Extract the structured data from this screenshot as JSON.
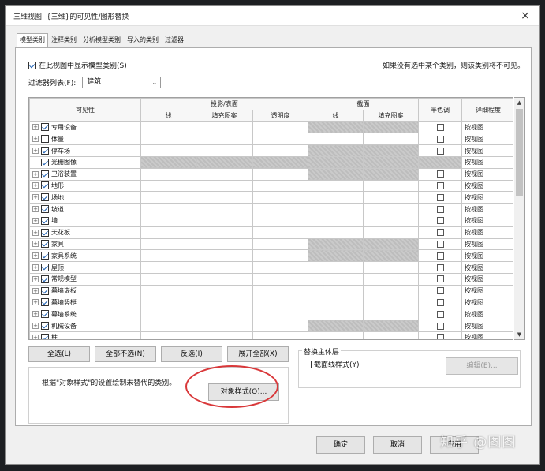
{
  "window": {
    "title": "三维视图: {三维}的可见性/图形替换",
    "close": "×"
  },
  "tabs": [
    {
      "label": "模型类别",
      "active": true
    },
    {
      "label": "注释类别",
      "active": false
    },
    {
      "label": "分析模型类别",
      "active": false
    },
    {
      "label": "导入的类别",
      "active": false
    },
    {
      "label": "过滤器",
      "active": false
    }
  ],
  "show_models": {
    "label": "在此视图中显示模型类别(S)",
    "checked": true
  },
  "hint": "如果没有选中某个类别，则该类别将不可见。",
  "filter": {
    "label": "过滤器列表(F):",
    "value": "建筑"
  },
  "grid": {
    "headers": {
      "visibility": "可见性",
      "projection": "投影/表面",
      "section": "截面",
      "halftone": "半色调",
      "detail": "详细程度",
      "line": "线",
      "fill": "填充图案",
      "transparency": "透明度",
      "section_line": "线",
      "section_fill": "填充图案"
    },
    "rows": [
      {
        "name": "专用设备",
        "checked": true,
        "expandable": true,
        "section_gray": true,
        "all_gray": false,
        "halftone": true,
        "detail": "按视图"
      },
      {
        "name": "体量",
        "checked": false,
        "expandable": true,
        "section_gray": false,
        "all_gray": false,
        "halftone": true,
        "detail": "按视图"
      },
      {
        "name": "停车场",
        "checked": true,
        "expandable": true,
        "section_gray": true,
        "all_gray": false,
        "halftone": true,
        "detail": "按视图"
      },
      {
        "name": "光栅图像",
        "checked": true,
        "expandable": false,
        "section_gray": true,
        "all_gray": true,
        "halftone": false,
        "detail": "按视图"
      },
      {
        "name": "卫浴装置",
        "checked": true,
        "expandable": true,
        "section_gray": true,
        "all_gray": false,
        "halftone": true,
        "detail": "按视图"
      },
      {
        "name": "地形",
        "checked": true,
        "expandable": true,
        "section_gray": false,
        "all_gray": false,
        "halftone": true,
        "detail": "按视图"
      },
      {
        "name": "场地",
        "checked": true,
        "expandable": true,
        "section_gray": false,
        "all_gray": false,
        "halftone": true,
        "detail": "按视图"
      },
      {
        "name": "坡道",
        "checked": true,
        "expandable": true,
        "section_gray": false,
        "all_gray": false,
        "halftone": true,
        "detail": "按视图"
      },
      {
        "name": "墙",
        "checked": true,
        "expandable": true,
        "section_gray": false,
        "all_gray": false,
        "halftone": true,
        "detail": "按视图"
      },
      {
        "name": "天花板",
        "checked": true,
        "expandable": true,
        "section_gray": false,
        "all_gray": false,
        "halftone": true,
        "detail": "按视图"
      },
      {
        "name": "家具",
        "checked": true,
        "expandable": true,
        "section_gray": true,
        "all_gray": false,
        "halftone": true,
        "detail": "按视图"
      },
      {
        "name": "家具系统",
        "checked": true,
        "expandable": true,
        "section_gray": true,
        "all_gray": false,
        "halftone": true,
        "detail": "按视图"
      },
      {
        "name": "屋顶",
        "checked": true,
        "expandable": true,
        "section_gray": false,
        "all_gray": false,
        "halftone": true,
        "detail": "按视图"
      },
      {
        "name": "常规模型",
        "checked": true,
        "expandable": true,
        "section_gray": false,
        "all_gray": false,
        "halftone": true,
        "detail": "按视图"
      },
      {
        "name": "幕墙嵌板",
        "checked": true,
        "expandable": true,
        "section_gray": false,
        "all_gray": false,
        "halftone": true,
        "detail": "按视图"
      },
      {
        "name": "幕墙竖梃",
        "checked": true,
        "expandable": true,
        "section_gray": false,
        "all_gray": false,
        "halftone": true,
        "detail": "按视图"
      },
      {
        "name": "幕墙系统",
        "checked": true,
        "expandable": true,
        "section_gray": false,
        "all_gray": false,
        "halftone": true,
        "detail": "按视图"
      },
      {
        "name": "机械设备",
        "checked": true,
        "expandable": true,
        "section_gray": true,
        "all_gray": false,
        "halftone": true,
        "detail": "按视图"
      },
      {
        "name": "柱",
        "checked": true,
        "expandable": true,
        "section_gray": false,
        "all_gray": false,
        "halftone": true,
        "detail": "按视图"
      }
    ]
  },
  "buttons": {
    "select_all": "全选(L)",
    "select_none": "全部不选(N)",
    "invert": "反选(I)",
    "expand_all": "展开全部(X)"
  },
  "override_host": {
    "title": "替换主体层",
    "cut_line_label": "截面线样式(Y)",
    "edit": "编辑(E)..."
  },
  "object_styles": {
    "label": "根据\"对象样式\"的设置绘制未替代的类别。",
    "button": "对象样式(O)..."
  },
  "footer": {
    "ok": "确定",
    "cancel": "取消",
    "apply": "应用"
  },
  "watermark": "知乎 @图图",
  "colors": {
    "highlight_ring": "#d9383a",
    "accent": "#1a5fb4"
  }
}
